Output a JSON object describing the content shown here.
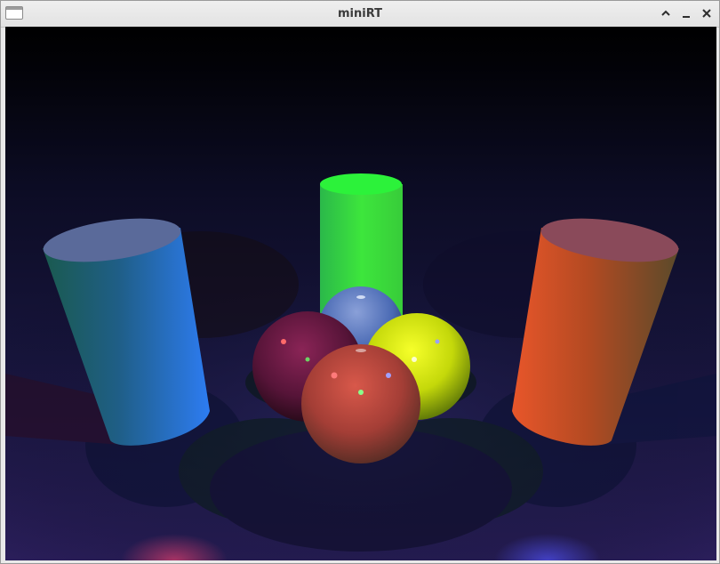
{
  "window": {
    "title": "miniRT",
    "icons": {
      "app": "window-app-icon",
      "maximize": "chevron-up-icon",
      "minimize": "minimize-icon",
      "close": "close-icon"
    }
  },
  "scene": {
    "background": "#0b0b1e",
    "objects": [
      {
        "kind": "cylinder",
        "name": "blue-cylinder",
        "color": "#2a6fd6"
      },
      {
        "kind": "cylinder",
        "name": "green-cylinder",
        "color": "#3aef3a"
      },
      {
        "kind": "cylinder",
        "name": "orange-cylinder",
        "color": "#e0501e"
      },
      {
        "kind": "sphere",
        "name": "blue-sphere",
        "color": "#5a82c8"
      },
      {
        "kind": "sphere",
        "name": "purple-sphere",
        "color": "#6a1a4a"
      },
      {
        "kind": "sphere",
        "name": "yellow-sphere",
        "color": "#d8e00a"
      },
      {
        "kind": "sphere",
        "name": "red-sphere",
        "color": "#b8443a"
      }
    ]
  }
}
